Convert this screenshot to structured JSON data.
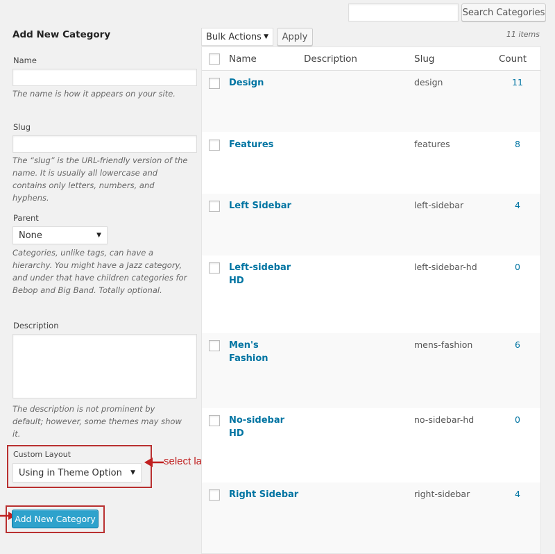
{
  "search": {
    "button_label": "Search Categories",
    "value": ""
  },
  "form": {
    "title": "Add New Category",
    "name_label": "Name",
    "name_help": "The name is how it appears on your site.",
    "slug_label": "Slug",
    "slug_help": "The “slug” is the URL-friendly version of the name. It is usually all lowercase and contains only letters, numbers, and hyphens.",
    "parent_label": "Parent",
    "parent_value": "None",
    "parent_help": "Categories, unlike tags, can have a hierarchy. You might have a Jazz category, and under that have children categories for Bebop and Big Band. Totally optional.",
    "description_label": "Description",
    "description_help": "The description is not prominent by default; however, some themes may show it.",
    "custom_layout_label": "Custom Layout",
    "custom_layout_value": "Using in Theme Option",
    "submit_label": "Add New Category"
  },
  "annotation": {
    "text": "select layout for Category Blog",
    "color": "#c02020"
  },
  "toolbar": {
    "bulk_actions": "Bulk Actions",
    "apply_label": "Apply",
    "items_count": "11 items"
  },
  "table": {
    "columns": {
      "name": "Name",
      "description": "Description",
      "slug": "Slug",
      "count": "Count"
    },
    "rows": [
      {
        "name": "Design",
        "slug": "design",
        "count": "11"
      },
      {
        "name": "Features",
        "slug": "features",
        "count": "8"
      },
      {
        "name": "Left Sidebar",
        "slug": "left-sidebar",
        "count": "4"
      },
      {
        "name": "Left-sidebar HD",
        "slug": "left-sidebar-hd",
        "count": "0"
      },
      {
        "name": "Men's Fashion",
        "slug": "mens-fashion",
        "count": "6"
      },
      {
        "name": "No-sidebar HD",
        "slug": "no-sidebar-hd",
        "count": "0"
      },
      {
        "name": "Right Sidebar",
        "slug": "right-sidebar",
        "count": "4"
      }
    ]
  },
  "colors": {
    "link": "#0074a2",
    "primary_button": "#2ea2cc",
    "highlight_border": "#b93030"
  }
}
